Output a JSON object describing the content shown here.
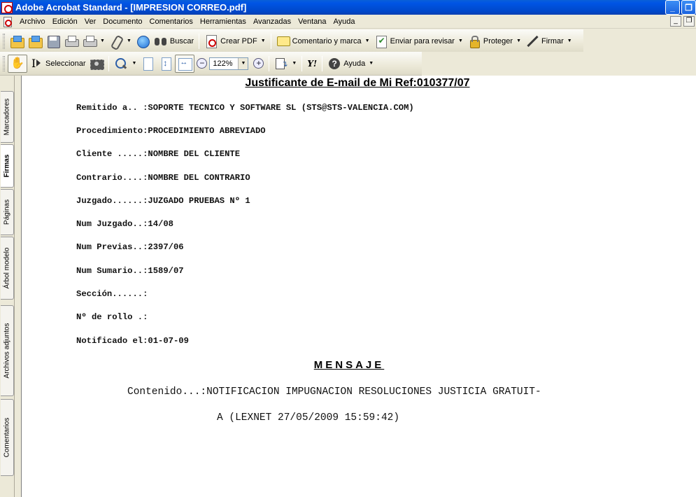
{
  "window": {
    "title": "Adobe Acrobat Standard - [IMPRESION CORREO.pdf]",
    "minimize": "_",
    "restore": "❐",
    "doc_minimize": "_",
    "doc_restore": "❐"
  },
  "menu": [
    "Archivo",
    "Edición",
    "Ver",
    "Documento",
    "Comentarios",
    "Herramientas",
    "Avanzadas",
    "Ventana",
    "Ayuda"
  ],
  "toolbar1": {
    "search_label": "Buscar",
    "create_pdf_label": "Crear PDF",
    "comment_label": "Comentario y marca",
    "send_review_label": "Enviar para revisar",
    "protect_label": "Proteger",
    "sign_label": "Firmar"
  },
  "toolbar2": {
    "select_label": "Seleccionar",
    "zoom_value": "122%",
    "zoom_out": "−",
    "zoom_in": "+",
    "yahoo_label": "Y!",
    "help_label": "Ayuda"
  },
  "nav_tabs": {
    "bookmarks": "Marcadores",
    "signatures": "Firmas",
    "pages": "Páginas",
    "model_tree": "Árbol modelo",
    "attachments": "Archivos adjuntos",
    "comments": "Comentarios"
  },
  "document": {
    "title": "Justificante de E-mail de Mi Ref:010377/07",
    "fields": [
      "Remitido a.. :SOPORTE TECNICO Y SOFTWARE SL (STS@STS-VALENCIA.COM)",
      "Procedimiento:PROCEDIMIENTO ABREVIADO",
      "Cliente .....:NOMBRE DEL CLIENTE",
      "Contrario....:NOMBRE DEL CONTRARIO",
      "Juzgado......:JUZGADO PRUEBAS Nº 1",
      "Num Juzgado..:14/08",
      "Num Previas..:2397/06",
      "Num Sumario..:1589/07",
      "Sección......:",
      "Nº de rollo .:",
      "Notificado el:01-07-09"
    ],
    "message_heading": "MENSAJE",
    "message_line1": "Contenido...:NOTIFICACION IMPUGNACION RESOLUCIONES JUSTICIA GRATUIT-",
    "message_line2": "A (LEXNET 27/05/2009 15:59:42)"
  }
}
